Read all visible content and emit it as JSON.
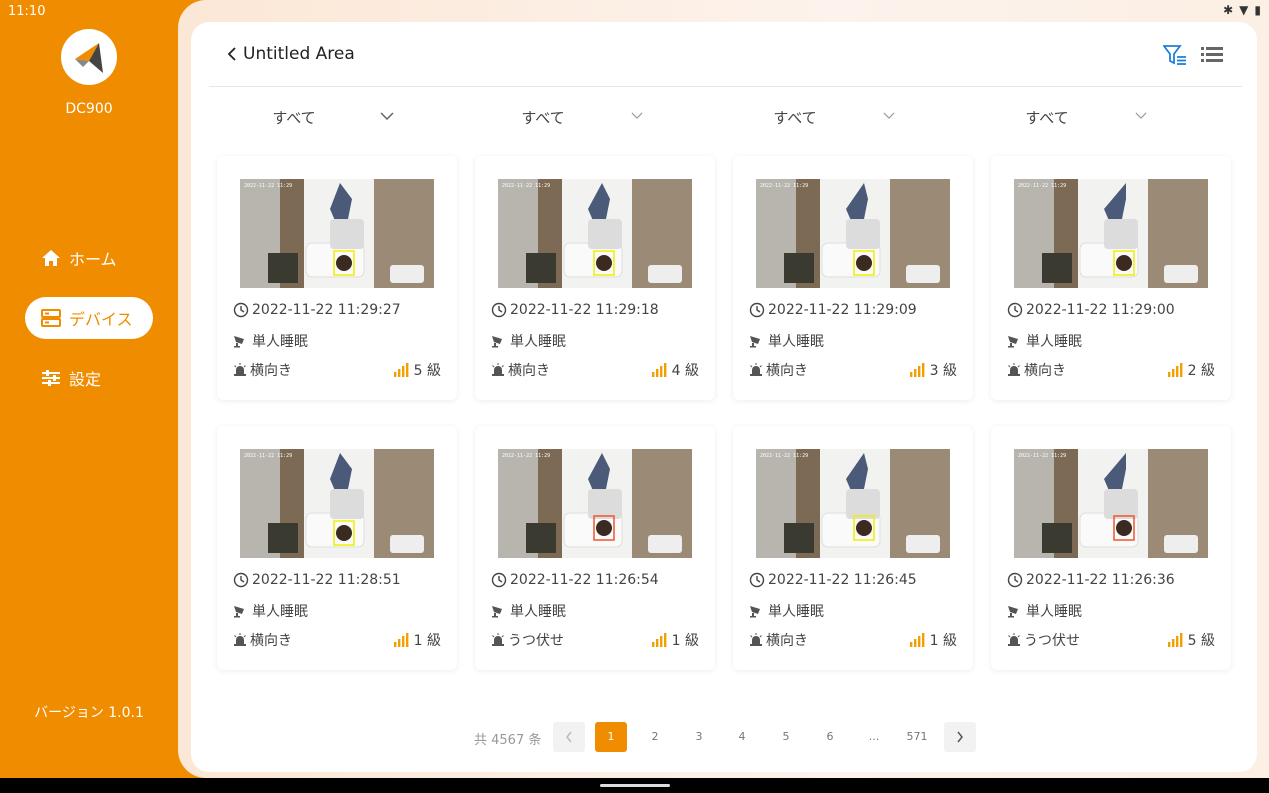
{
  "status_bar": {
    "time": "11:10"
  },
  "sidebar": {
    "device_name": "DC900",
    "nav": [
      {
        "label": "ホーム",
        "icon": "home-icon"
      },
      {
        "label": "デバイス",
        "icon": "device-icon",
        "active": true
      },
      {
        "label": "設定",
        "icon": "settings-sliders-icon"
      }
    ],
    "version": "バージョン 1.0.1"
  },
  "header": {
    "title": "Untitled Area"
  },
  "filters": [
    "すべて",
    "すべて",
    "すべて",
    "すべて"
  ],
  "cards": [
    {
      "timestamp": "2022-11-22 11:29:27",
      "mode": "単人睡眠",
      "pose": "横向き",
      "level": "5 級"
    },
    {
      "timestamp": "2022-11-22 11:29:18",
      "mode": "単人睡眠",
      "pose": "横向き",
      "level": "4 級"
    },
    {
      "timestamp": "2022-11-22 11:29:09",
      "mode": "単人睡眠",
      "pose": "横向き",
      "level": "3 級"
    },
    {
      "timestamp": "2022-11-22 11:29:00",
      "mode": "単人睡眠",
      "pose": "横向き",
      "level": "2 級"
    },
    {
      "timestamp": "2022-11-22 11:28:51",
      "mode": "単人睡眠",
      "pose": "横向き",
      "level": "1 級"
    },
    {
      "timestamp": "2022-11-22 11:26:54",
      "mode": "単人睡眠",
      "pose": "うつ伏せ",
      "level": "1 級"
    },
    {
      "timestamp": "2022-11-22 11:26:45",
      "mode": "単人睡眠",
      "pose": "横向き",
      "level": "1 級"
    },
    {
      "timestamp": "2022-11-22 11:26:36",
      "mode": "単人睡眠",
      "pose": "うつ伏せ",
      "level": "5 級"
    }
  ],
  "pagination": {
    "total": "共 4567 条",
    "pages": [
      "1",
      "2",
      "3",
      "4",
      "5",
      "6",
      "...",
      "571"
    ],
    "current": "1"
  },
  "colors": {
    "accent": "#f08c00",
    "level_icon": "#f0a000"
  }
}
